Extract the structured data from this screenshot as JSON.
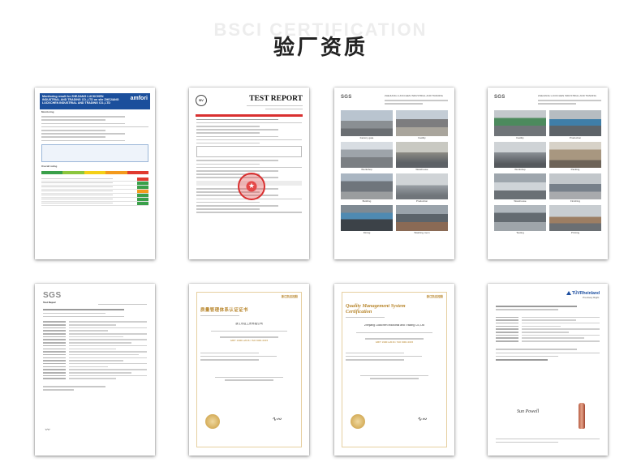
{
  "page": {
    "watermark": "BSCI CERTIFICATION",
    "title": "验厂资质"
  },
  "certificates": [
    {
      "id": "amfori",
      "header": "Monitoring result for ZHEJIANG LUCKCHEN INDUSTRIAL AND TRADING CO.,LTD on site ZHEJIANG LUCKCHEN INDUSTRIAL AND TRADING CO.,LTD",
      "logo": "amfori",
      "section": "Monitoring",
      "rating_section": "Overall rating",
      "rating_colors": [
        "#3aa04a",
        "#8cc63e",
        "#f4d018",
        "#f39a1d",
        "#e03a2f"
      ],
      "row_colors": [
        "#e03a2f",
        "#3aa04a",
        "#3aa04a",
        "#f39a1d",
        "#3aa04a",
        "#3aa04a"
      ]
    },
    {
      "id": "bv-test-report",
      "logo": "BV",
      "title": "TEST REPORT",
      "seal_color": "#d93030"
    },
    {
      "id": "sgs-photo-report-1",
      "logo": "SGS",
      "company": "ZHEJIANG LUCKCHEN INDUSTRIAL AND TRADING",
      "captions": [
        "Factory gate",
        "Facility",
        "Workshop",
        "Warehouse",
        "Building",
        "Production",
        "Dining",
        "Washing room"
      ]
    },
    {
      "id": "sgs-photo-report-2",
      "logo": "SGS",
      "company": "ZHEJIANG LUCKCHEN INDUSTRIAL AND TRADING",
      "captions": [
        "Facility",
        "Production",
        "Workshop",
        "Packing",
        "Warehouse",
        "Finishing",
        "Testing",
        "Printing"
      ]
    },
    {
      "id": "sgs-test-report",
      "logo": "SGS",
      "label": "Test Report"
    },
    {
      "id": "cn-quality-cert",
      "brand": "浙江凯达控股",
      "title": "质量管理体系认证证书",
      "company": "浙江乐臣工贸有限公司",
      "standard": "GB/T 19001-2016 / ISO 9001:2015"
    },
    {
      "id": "en-quality-cert",
      "brand": "浙江凯达控股",
      "title": "Quality Management System Certification",
      "company": "Zhejiang Luckchen Industrial and Trading Co.,Ltd",
      "standard": "GB/T 19001-2016 / ISO 9001:2015"
    },
    {
      "id": "tuv-report",
      "logo": "TÜVRheinland",
      "tagline": "Precisely Right.",
      "signature": "Sun Powell"
    }
  ]
}
